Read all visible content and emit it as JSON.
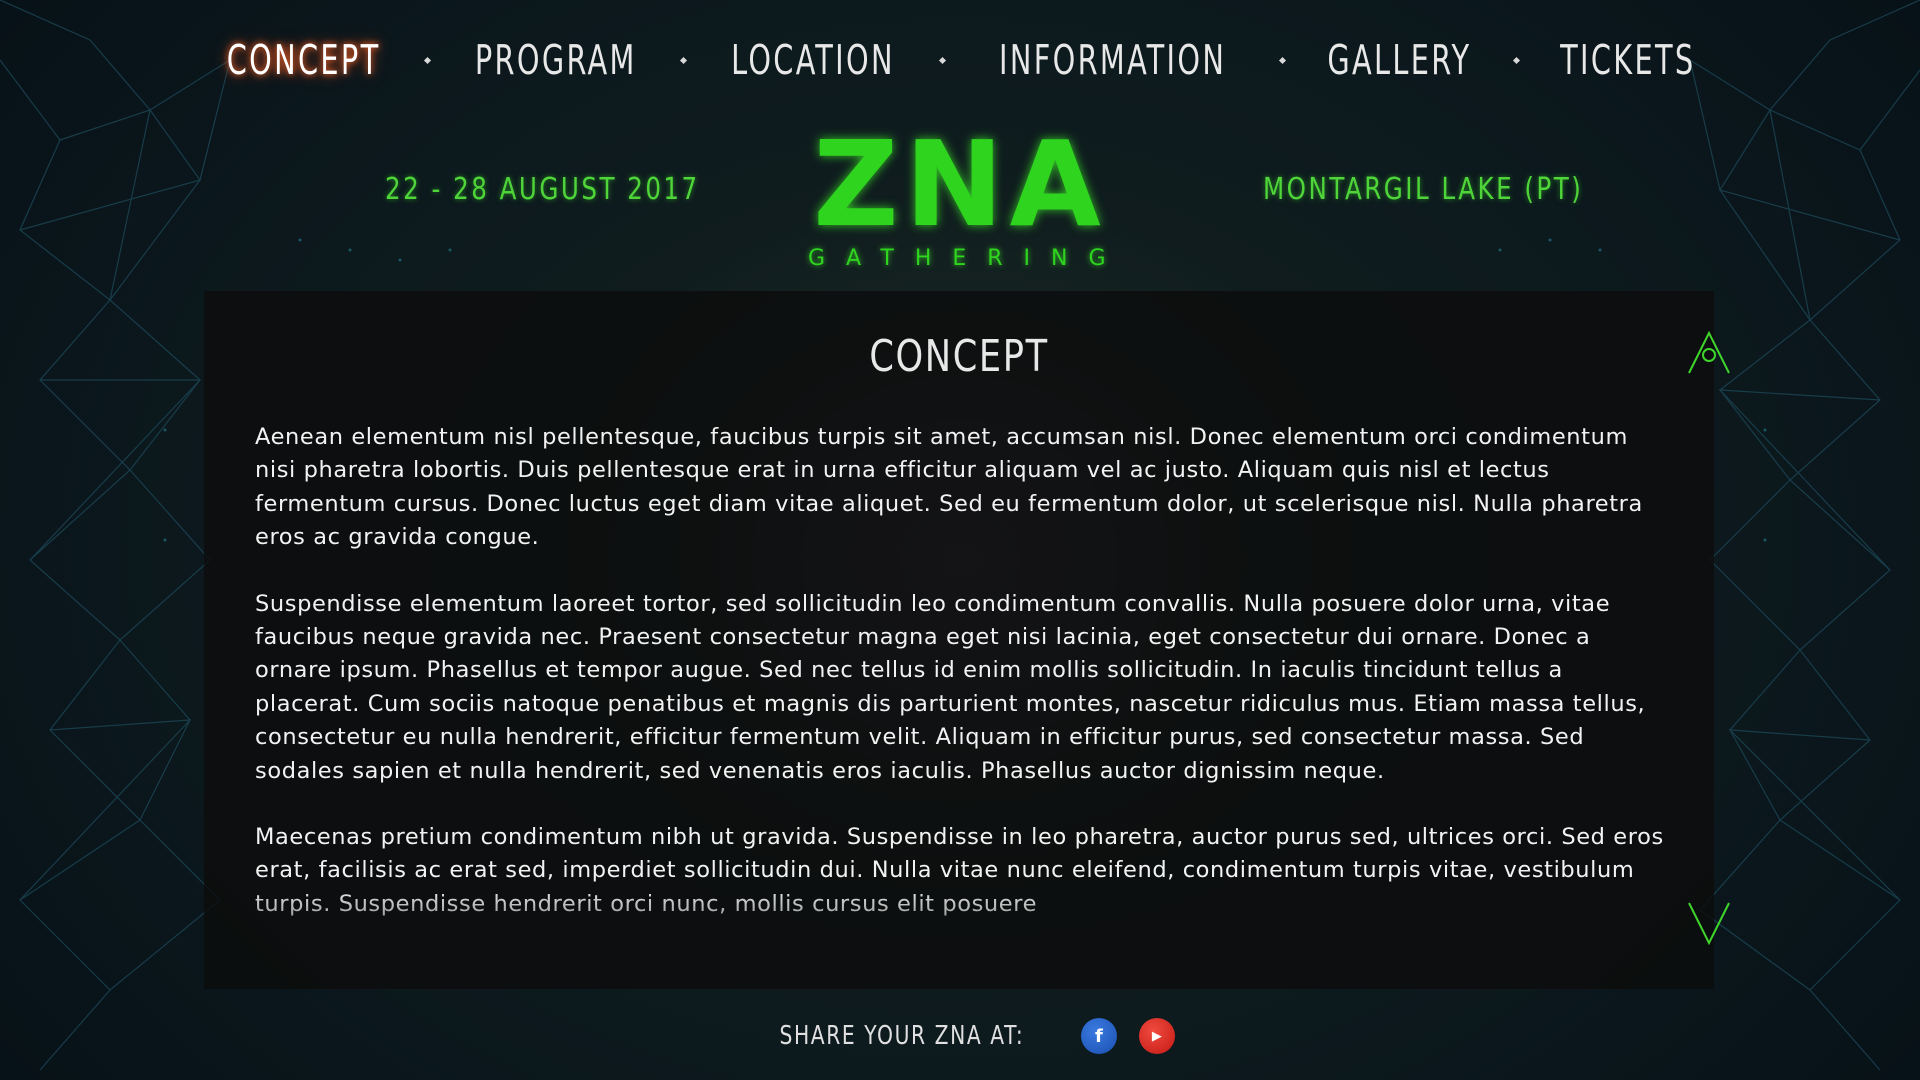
{
  "nav": {
    "items": [
      {
        "label": "CONCEPT",
        "active": true
      },
      {
        "label": "PROGRAM",
        "active": false
      },
      {
        "label": "LOCATION",
        "active": false
      },
      {
        "label": "INFORMATION",
        "active": false
      },
      {
        "label": "GALLERY",
        "active": false
      },
      {
        "label": "TICKETS",
        "active": false
      }
    ]
  },
  "header": {
    "dates": "22 - 28 AUGUST 2017",
    "location": "MONTARGIL LAKE (PT)",
    "logo_text": "ZNA",
    "logo_subtext": "GATHERING"
  },
  "main": {
    "title": "CONCEPT",
    "paragraphs": [
      "Aenean elementum nisl pellentesque, faucibus turpis sit amet, accumsan nisl. Donec elementum orci condimentum nisi pharetra lobortis. Duis pellentesque erat in urna efficitur aliquam vel ac justo. Aliquam quis nisl et lectus fermentum cursus. Donec luctus eget diam vitae aliquet. Sed eu fermentum dolor, ut scelerisque nisl. Nulla pharetra eros ac gravida congue.",
      "Suspendisse elementum laoreet tortor, sed sollicitudin leo condimentum convallis. Nulla posuere dolor urna, vitae faucibus neque gravida nec. Praesent consectetur magna eget nisi lacinia, eget consectetur dui ornare. Donec a ornare ipsum. Phasellus et tempor augue. Sed nec tellus id enim mollis sollicitudin. In iaculis tincidunt tellus a placerat. Cum sociis natoque penatibus et magnis dis parturient montes, nascetur ridiculus mus. Etiam massa tellus, consectetur eu nulla hendrerit, efficitur fermentum velit. Aliquam in efficitur purus, sed consectetur massa. Sed sodales sapien et nulla hendrerit, sed venenatis eros iaculis. Phasellus auctor dignissim neque.",
      "Maecenas pretium condimentum nibh ut gravida. Suspendisse in leo pharetra, auctor purus sed, ultrices orci. Sed eros erat, facilisis ac erat sed, imperdiet sollicitudin dui. Nulla vitae nunc eleifend, condimentum turpis vitae, vestibulum turpis. Suspendisse hendrerit orci nunc, mollis cursus elit posuere"
    ]
  },
  "footer": {
    "share_label": "SHARE YOUR ZNA AT:",
    "facebook_glyph": "f",
    "youtube_glyph": "▶"
  },
  "colors": {
    "accent_green": "#2fd41f",
    "active_glow": "#ff6a2a"
  }
}
